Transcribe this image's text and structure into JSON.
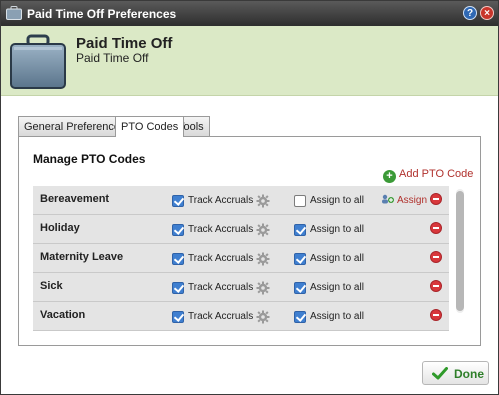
{
  "window": {
    "title": "Paid Time Off Preferences"
  },
  "header": {
    "title": "Paid Time Off",
    "subtitle": "Paid Time Off"
  },
  "tabs": [
    {
      "label": "General Preferences",
      "active": false
    },
    {
      "label": "PTO Codes",
      "active": true
    },
    {
      "label": "Tools",
      "active": false
    }
  ],
  "panel": {
    "title": "Manage PTO Codes",
    "add_label": "Add PTO Code"
  },
  "columns": {
    "track_label": "Track Accruals",
    "assign_label": "Assign to all",
    "assign_link": "Assign"
  },
  "rows": [
    {
      "name": "Bereavement",
      "track_accruals": true,
      "assign_to_all": false,
      "show_assign_link": true
    },
    {
      "name": "Holiday",
      "track_accruals": true,
      "assign_to_all": true,
      "show_assign_link": false
    },
    {
      "name": "Maternity Leave",
      "track_accruals": true,
      "assign_to_all": true,
      "show_assign_link": false
    },
    {
      "name": "Sick",
      "track_accruals": true,
      "assign_to_all": true,
      "show_assign_link": false
    },
    {
      "name": "Vacation",
      "track_accruals": true,
      "assign_to_all": true,
      "show_assign_link": false
    }
  ],
  "footer": {
    "done_label": "Done"
  },
  "colors": {
    "header_bg": "#dbe9c6",
    "accent_red": "#b0302c",
    "done_green": "#2f7f2a"
  }
}
